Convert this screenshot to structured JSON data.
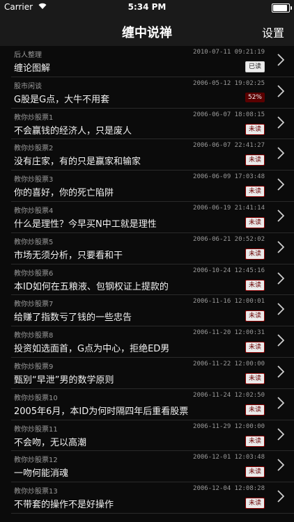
{
  "status": {
    "carrier": "Carrier",
    "time": "5:34 PM"
  },
  "nav": {
    "title": "缠中说禅",
    "settings_label": "设置"
  },
  "rows": [
    {
      "category": "后人整理",
      "date": "2010-07-11 09:21:19",
      "title": "缠论图解",
      "badge": "已读",
      "badge_type": "read"
    },
    {
      "category": "股市闲谈",
      "date": "2006-05-12 19:02:25",
      "title": "G股是G点，大牛不用套",
      "badge": "52%",
      "badge_type": "pct"
    },
    {
      "category": "教你炒股票1",
      "date": "2006-06-07 18:08:15",
      "title": "不会赢钱的经济人，只是废人",
      "badge": "未读",
      "badge_type": "unread"
    },
    {
      "category": "教你炒股票2",
      "date": "2006-06-07 22:41:27",
      "title": "没有庄家，有的只是赢家和输家",
      "badge": "未读",
      "badge_type": "unread"
    },
    {
      "category": "教你炒股票3",
      "date": "2006-06-09 17:03:48",
      "title": "你的喜好，你的死亡陷阱",
      "badge": "未读",
      "badge_type": "unread"
    },
    {
      "category": "教你炒股票4",
      "date": "2006-06-19 21:41:14",
      "title": "什么是理性？今早买N中工就是理性",
      "badge": "未读",
      "badge_type": "unread"
    },
    {
      "category": "教你炒股票5",
      "date": "2006-06-21 20:52:02",
      "title": "市场无须分析，只要看和干",
      "badge": "未读",
      "badge_type": "unread"
    },
    {
      "category": "教你炒股票6",
      "date": "2006-10-24 12:45:16",
      "title": "本ID如何在五粮液、包钢权证上提款的",
      "badge": "未读",
      "badge_type": "unread"
    },
    {
      "category": "教你炒股票7",
      "date": "2006-11-16 12:00:01",
      "title": "给赚了指数亏了钱的一些忠告",
      "badge": "未读",
      "badge_type": "unread"
    },
    {
      "category": "教你炒股票8",
      "date": "2006-11-20 12:00:31",
      "title": "投资如选面首，G点为中心，拒绝ED男",
      "badge": "未读",
      "badge_type": "unread"
    },
    {
      "category": "教你炒股票9",
      "date": "2006-11-22 12:00:00",
      "title": "甄别“早泄”男的数学原则",
      "badge": "未读",
      "badge_type": "unread"
    },
    {
      "category": "教你炒股票10",
      "date": "2006-11-24 12:02:50",
      "title": "2005年6月，本ID为何时隔四年后重看股票",
      "badge": "未读",
      "badge_type": "unread"
    },
    {
      "category": "教你炒股票11",
      "date": "2006-11-29 12:00:00",
      "title": "不会吻，无以高潮",
      "badge": "未读",
      "badge_type": "unread"
    },
    {
      "category": "教你炒股票12",
      "date": "2006-12-01 12:03:48",
      "title": "一吻何能消魂",
      "badge": "未读",
      "badge_type": "unread"
    },
    {
      "category": "教你炒股票13",
      "date": "2006-12-04 12:08:28",
      "title": "不带套的操作不是好操作",
      "badge": "未读",
      "badge_type": "unread"
    }
  ]
}
